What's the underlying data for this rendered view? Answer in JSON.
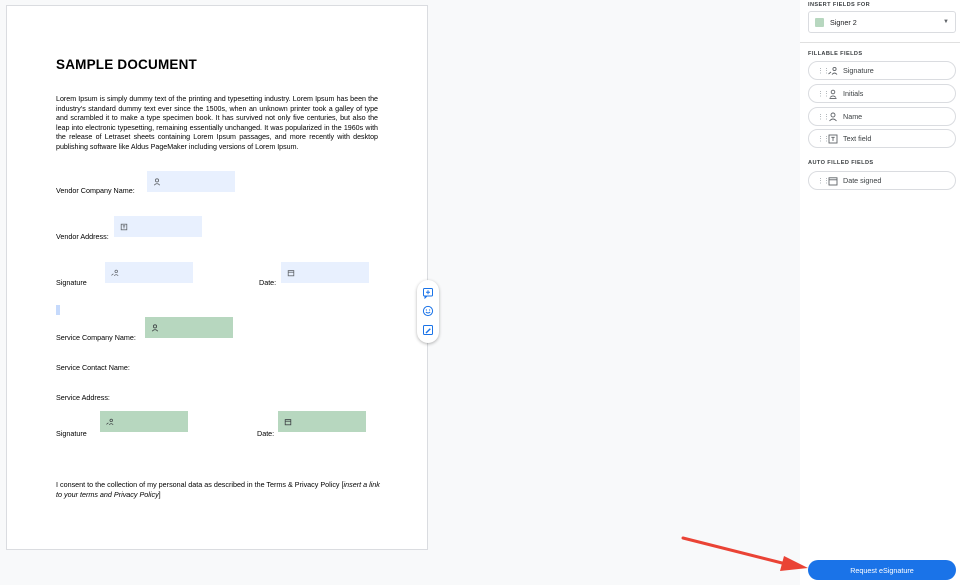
{
  "document": {
    "title": "SAMPLE DOCUMENT",
    "body": "Lorem Ipsum is simply dummy text of the printing and typesetting industry. Lorem Ipsum has been the industry's standard dummy text ever since the 1500s, when an unknown printer took a galley of type and scrambled it to make a type specimen book. It has survived not only five centuries, but also the leap into electronic typesetting, remaining essentially unchanged. It was popularized in the 1960s with the release of Letraset sheets containing Lorem Ipsum passages, and more recently with desktop publishing software like Aldus PageMaker including versions of Lorem Ipsum.",
    "labels": {
      "vendor_company": "Vendor Company Name:",
      "vendor_address": "Vendor Address:",
      "signature_1": "Signature",
      "date_1": "Date:",
      "service_company": "Service Company Name:",
      "service_contact": "Service Contact Name:",
      "service_address": "Service Address:",
      "signature_2": "Signature",
      "date_2": "Date:"
    },
    "consent_text": "I consent to the collection of my personal data as described in the Terms & Privacy Policy [",
    "consent_italic": "insert a link to your terms and Privacy Policy",
    "consent_end": "]"
  },
  "panel": {
    "insert_fields_label": "INSERT FIELDS FOR",
    "signer": "Signer 2",
    "fillable_label": "FILLABLE FIELDS",
    "fillable_fields": [
      "Signature",
      "Initials",
      "Name",
      "Text field"
    ],
    "auto_filled_label": "AUTO FILLED FIELDS",
    "auto_fields": [
      "Date signed"
    ],
    "request_button": "Request eSignature"
  },
  "colors": {
    "signer1_field": "#e8f0fe",
    "signer2_field": "#b7d7bf",
    "accent": "#1a73e8",
    "arrow": "#ea4335"
  },
  "icons": {
    "toolbar": [
      "add-comment-icon",
      "emoji-icon",
      "suggest-edit-icon"
    ]
  }
}
